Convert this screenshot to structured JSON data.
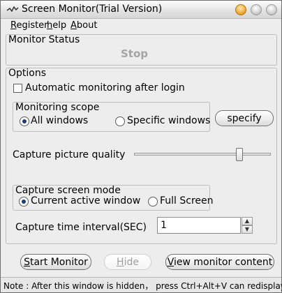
{
  "window": {
    "title": "Screen Monitor(Trial Version)"
  },
  "menu": [
    {
      "key": "R",
      "rest": "egister"
    },
    {
      "key": "h",
      "rest": "elp"
    },
    {
      "key": "A",
      "rest": "bout"
    }
  ],
  "monitor_status": {
    "label": "Monitor Status",
    "value": "Stop"
  },
  "options": {
    "label": "Options",
    "auto_monitoring": {
      "label": "Automatic monitoring after login",
      "checked": false
    },
    "monitoring_scope": {
      "label": "Monitoring scope",
      "all_windows": "All windows",
      "specific_windows": "Specific windows",
      "selected": "All windows"
    },
    "specify_button": "specify",
    "capture_quality": {
      "label": "Capture picture quality",
      "level": 0.78
    },
    "capture_mode": {
      "label": "Capture screen mode",
      "current_active": "Current active window",
      "full_screen": "Full Screen",
      "selected": "Current active window"
    },
    "capture_interval": {
      "label": "Capture time interval(SEC)",
      "value": "1"
    }
  },
  "buttons": {
    "start_monitor": {
      "key": "S",
      "rest": "tart Monitor"
    },
    "hide": {
      "key": "H",
      "rest": "ide"
    },
    "view_content": {
      "key": "V",
      "rest": "iew monitor content"
    }
  },
  "status": "Note : After this window is hidden， press Ctrl+Alt+V can  redisplay.",
  "icons": {
    "app": "monitor-icon",
    "minimize": "minimize-icon",
    "maximize": "maximize-icon",
    "close": "close-icon"
  }
}
